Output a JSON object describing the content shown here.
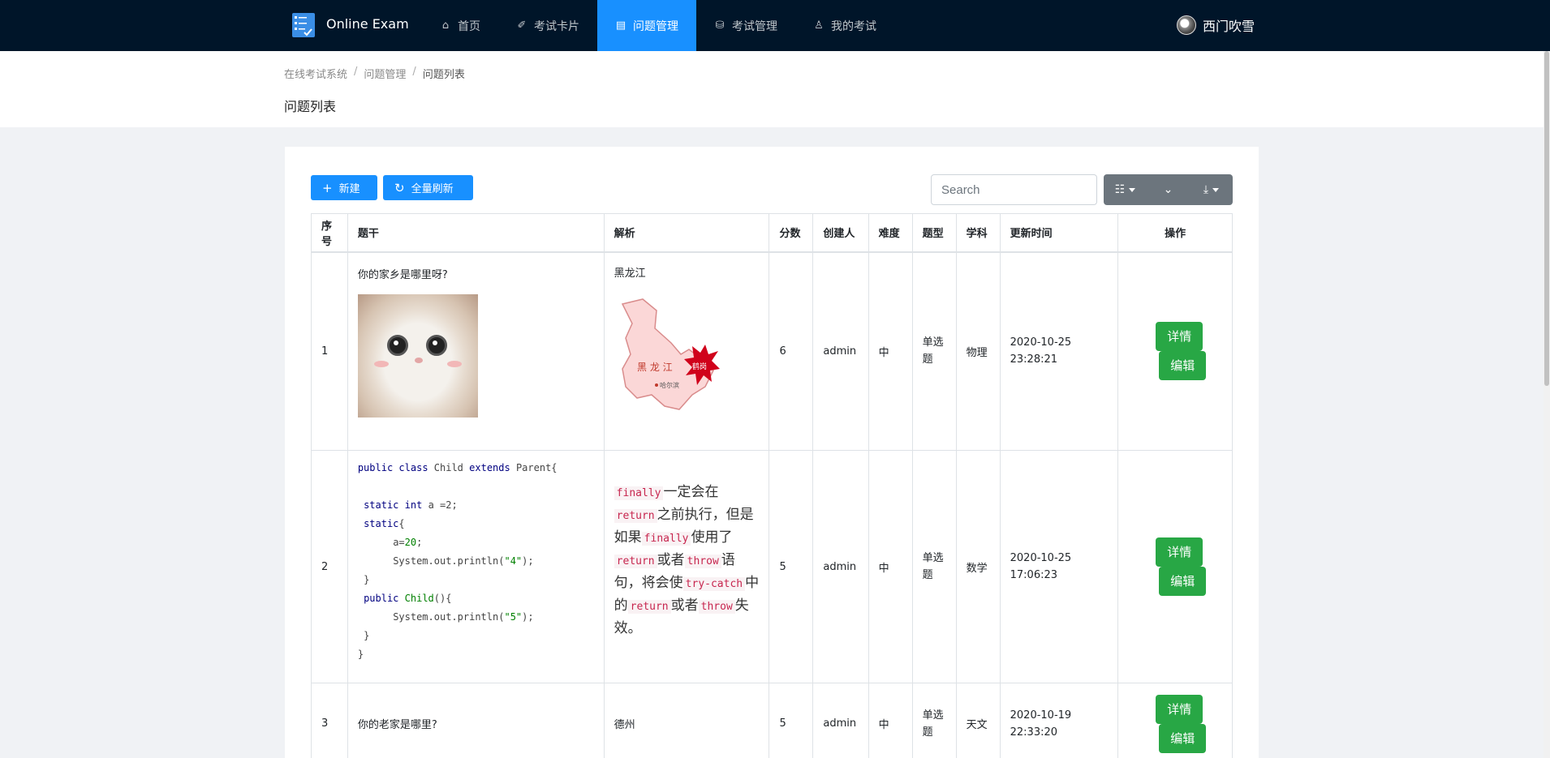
{
  "app": {
    "brand": "Online Exam"
  },
  "nav": [
    {
      "label": "首页",
      "icon": "home-icon",
      "glyph": "⌂",
      "active": false
    },
    {
      "label": "考试卡片",
      "icon": "card-icon",
      "glyph": "✐",
      "active": false
    },
    {
      "label": "问题管理",
      "icon": "question-icon",
      "glyph": "▤",
      "active": true
    },
    {
      "label": "考试管理",
      "icon": "exam-icon",
      "glyph": "⛁",
      "active": false
    },
    {
      "label": "我的考试",
      "icon": "user-icon",
      "glyph": "♙",
      "active": false
    }
  ],
  "user": {
    "name": "西门吹雪"
  },
  "breadcrumb": [
    "在线考试系统",
    "问题管理",
    "问题列表"
  ],
  "page_title": "问题列表",
  "toolbar": {
    "new_label": "新建",
    "refresh_label": "全量刷新",
    "search_placeholder": "Search"
  },
  "table": {
    "headers": [
      "序号",
      "题干",
      "解析",
      "分数",
      "创建人",
      "难度",
      "题型",
      "学科",
      "更新时间",
      "操作"
    ],
    "rows": [
      {
        "index": "1",
        "stem": "你的家乡是哪里呀?",
        "analysis": "黑龙江",
        "score": "6",
        "creator": "admin",
        "difficulty": "中",
        "type": "单选题",
        "subject": "物理",
        "updated": "2020-10-25 23:28:21"
      },
      {
        "index": "2",
        "score": "5",
        "creator": "admin",
        "difficulty": "中",
        "type": "单选题",
        "subject": "数学",
        "updated": "2020-10-25 17:06:23"
      },
      {
        "index": "3",
        "stem": "你的老家是哪里?",
        "analysis": "德州",
        "score": "5",
        "creator": "admin",
        "difficulty": "中",
        "type": "单选题",
        "subject": "天文",
        "updated": "2020-10-19 22:33:20"
      }
    ],
    "detail_label": "详情",
    "edit_label": "编辑"
  },
  "map_labels": {
    "province": "黑 龙 江",
    "city_star": "鹤岗",
    "capital": "哈尔滨"
  },
  "code_sample": {
    "l1": {
      "kw1": "public",
      "kw2": "class",
      "name": "Child",
      "kw3": "extends",
      "parent": "Parent{"
    },
    "l2": {
      "kw1": "static",
      "kw2": "int",
      "rest": "a =2;"
    },
    "l3": {
      "kw": "static",
      "rest": "{"
    },
    "l4": {
      "a": "a=",
      "n": "20",
      "end": ";"
    },
    "l5": {
      "a": "System.out.println(",
      "s": "\"4\"",
      "end": ");"
    },
    "l6": "}",
    "l7": {
      "kw": "public",
      "name": "Child",
      "end": "(){"
    },
    "l8": {
      "a": "System.out.println(",
      "s": "\"5\"",
      "end": ");"
    },
    "l9": "}",
    "l10": "}"
  },
  "analysis_2": {
    "c1": "finally",
    "t1": "一定会在",
    "c2": "return",
    "t2": "之前执行，但是如果",
    "c3": "finally",
    "t3": "使用了",
    "c4": "return",
    "t4": "或者",
    "c5": "throw",
    "t5": "语句，将会使",
    "c6": "try-catch",
    "t6": "中的",
    "c7": "return",
    "t7": "或者",
    "c8": "throw",
    "t8": "失效。"
  }
}
